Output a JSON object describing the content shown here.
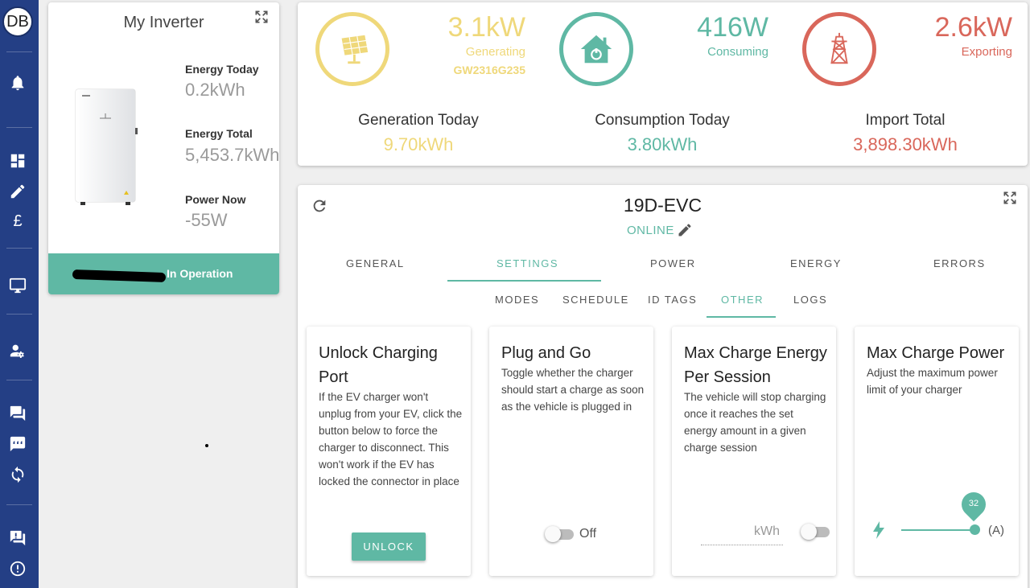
{
  "user": {
    "initials": "DB"
  },
  "sidebar": {
    "icons": [
      "bell-icon",
      "dashboard-icon",
      "pencil-icon",
      "pound-icon",
      "monitor-icon",
      "user-settings-icon",
      "chat-icon",
      "feedback-icon",
      "sync-icon",
      "question-icon",
      "alert-icon"
    ]
  },
  "inverter": {
    "title": "My Inverter",
    "energy_today_label": "Energy Today",
    "energy_today_value": "0.2kWh",
    "energy_total_label": "Energy Total",
    "energy_total_value": "5,453.7kWh",
    "power_now_label": "Power Now",
    "power_now_value": "-55W",
    "status": "In Operation"
  },
  "summary": {
    "generating_value": "3.1kW",
    "generating_label": "Generating",
    "inverter_id": "GW2316G235",
    "consuming_value": "416W",
    "consuming_label": "Consuming",
    "exporting_value": "2.6kW",
    "exporting_label": "Exporting",
    "generation_today_label": "Generation Today",
    "generation_today_value": "9.70kWh",
    "consumption_today_label": "Consumption Today",
    "consumption_today_value": "3.80kWh",
    "import_total_label": "Import Total",
    "import_total_value": "3,898.30kWh"
  },
  "colors": {
    "sidebar": "#243f85",
    "solar": "#efd87a",
    "teal": "#5fb8a4",
    "red": "#d9675b"
  },
  "charger": {
    "name": "19D-EVC",
    "status": "ONLINE",
    "tabs": [
      "GENERAL",
      "SETTINGS",
      "POWER",
      "ENERGY",
      "ERRORS"
    ],
    "active_tab": "SETTINGS",
    "subtabs": [
      "MODES",
      "SCHEDULE",
      "ID TAGS",
      "OTHER",
      "LOGS"
    ],
    "active_subtab": "OTHER",
    "settings": {
      "unlock": {
        "title": "Unlock Charging Port",
        "description": "If the EV charger won't unplug from your EV, click the button below to force the charger to disconnect. This won't work if the EV has locked the connector in place",
        "button": "UNLOCK"
      },
      "plug_and_go": {
        "title": "Plug and Go",
        "description": "Toggle whether the charger should start a charge as soon as the vehicle is plugged in",
        "toggle_label": "Off",
        "enabled": false
      },
      "max_energy": {
        "title": "Max Charge Energy Per Session",
        "description": "The vehicle will stop charging once it reaches the set energy amount in a given charge session",
        "placeholder": "kWh",
        "enabled": false
      },
      "max_power": {
        "title": "Max Charge Power",
        "description": "Adjust the maximum power limit of your charger",
        "value": "32",
        "unit": "(A)"
      }
    }
  }
}
